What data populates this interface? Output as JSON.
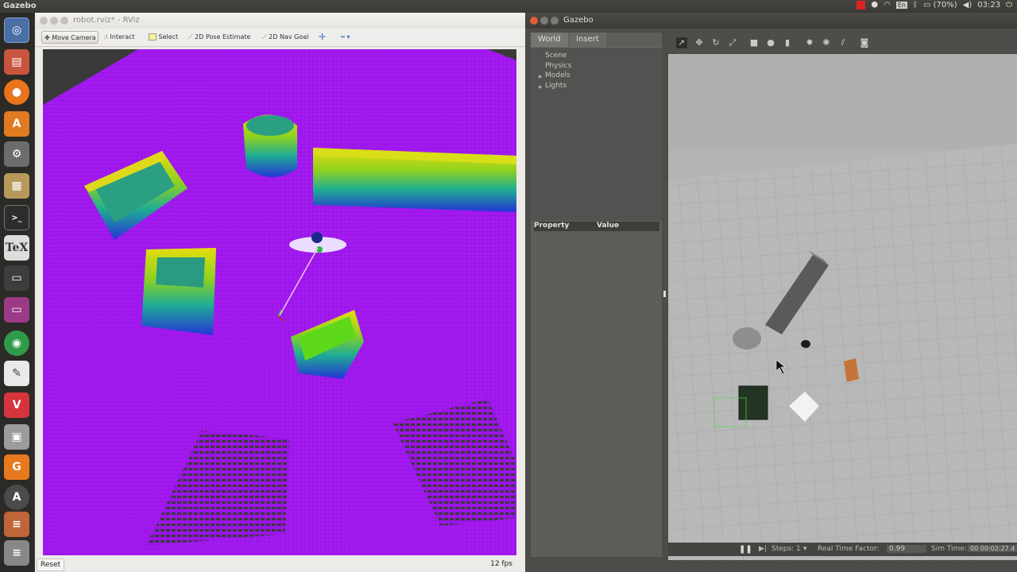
{
  "topbar": {
    "app_name": "Gazebo",
    "keyboard": "En",
    "battery": "(70%)",
    "clock": "03:23"
  },
  "launcher": {
    "icons": [
      "dash-icon",
      "files-icon",
      "firefox-icon",
      "software-center-icon",
      "settings-icon",
      "archive-icon",
      "terminal-icon",
      "tex-icon",
      "window-icon",
      "app-icon",
      "chrome-icon",
      "text-editor-icon",
      "vivaldi-icon",
      "printer-icon",
      "pdf-icon",
      "updater-icon",
      "stack-icon",
      "stack-icon-2"
    ]
  },
  "rviz": {
    "title": "robot.rviz* - RViz",
    "tools": [
      "Move Camera",
      "Interact",
      "Select",
      "2D Pose Estimate",
      "2D Nav Goal"
    ],
    "reset_label": "Reset",
    "fps": "12 fps"
  },
  "gazebo": {
    "title": "Gazebo",
    "tabs": [
      "World",
      "Insert"
    ],
    "tree": [
      {
        "label": "Scene",
        "expandable": false
      },
      {
        "label": "Physics",
        "expandable": false
      },
      {
        "label": "Models",
        "expandable": true
      },
      {
        "label": "Lights",
        "expandable": true
      }
    ],
    "property_header": "Property",
    "value_header": "Value",
    "steps_label": "Steps:",
    "steps_value": "1",
    "rtf_label": "Real Time Factor:",
    "rtf_value": "0.99",
    "sim_time_label": "Sim Time:",
    "sim_time_value": "00 00:02:27.4"
  }
}
